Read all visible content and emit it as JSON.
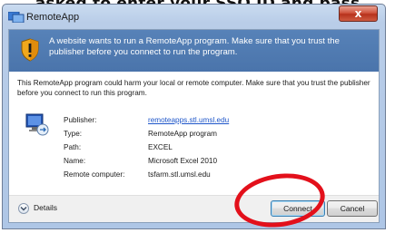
{
  "caption": {
    "text": "asked to enter your SSO ID and pass"
  },
  "window": {
    "title": "RemoteApp",
    "close_label": "x"
  },
  "banner": {
    "text": "A website wants to run a RemoteApp program. Make sure that you trust the publisher before you connect to run the program."
  },
  "body": {
    "warning_text": "This RemoteApp program could harm your local or remote computer. Make sure that you trust the publisher before you connect to run this program."
  },
  "details": {
    "rows": [
      {
        "label": "Publisher:",
        "value": "remoteapps.stl.umsl.edu"
      },
      {
        "label": "Type:",
        "value": "RemoteApp program"
      },
      {
        "label": "Path:",
        "value": "EXCEL"
      },
      {
        "label": "Name:",
        "value": "Microsoft Excel 2010"
      },
      {
        "label": "Remote computer:",
        "value": "tsfarm.stl.umsl.edu"
      }
    ]
  },
  "footer": {
    "details_label": "Details",
    "connect_label": "Connect",
    "cancel_label": "Cancel"
  },
  "colors": {
    "banner_bg": "#4a74ab",
    "link": "#1d55c9",
    "annotation_circle": "#e3101b",
    "close_button": "#c7432c"
  },
  "icons": [
    "remoteapp-icon",
    "close-icon",
    "shield-warning-icon",
    "computer-icon",
    "chevron-down-icon"
  ]
}
